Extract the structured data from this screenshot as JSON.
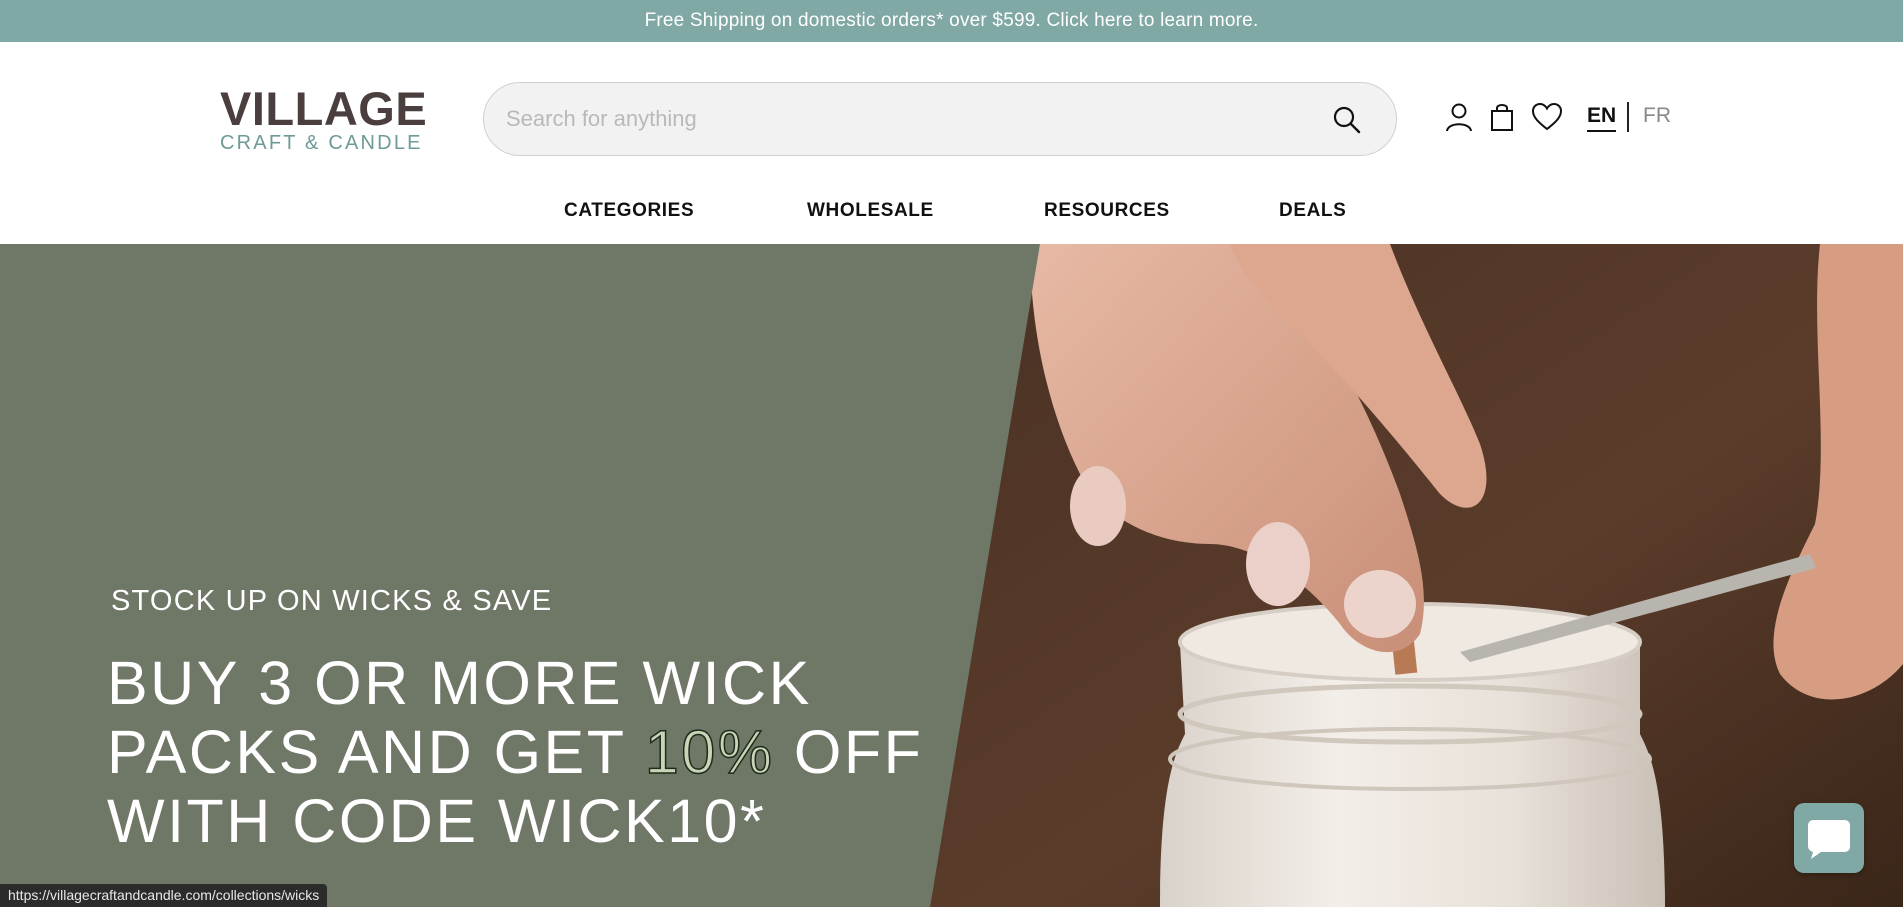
{
  "announcement": {
    "text": "Free Shipping on domestic orders* over $599. Click here to learn more."
  },
  "logo": {
    "main": "VILLAGE",
    "sub": "CRAFT & CANDLE"
  },
  "search": {
    "placeholder": "Search for anything",
    "value": "",
    "icon": "search-icon"
  },
  "header_icons": [
    "account-icon",
    "cart-icon",
    "wishlist-heart-icon"
  ],
  "language": {
    "active": "EN",
    "other": "FR"
  },
  "nav": {
    "items": [
      {
        "label": "CATEGORIES"
      },
      {
        "label": "WHOLESALE"
      },
      {
        "label": "RESOURCES"
      },
      {
        "label": "DEALS"
      }
    ]
  },
  "hero": {
    "kicker": "STOCK UP ON WICKS & SAVE",
    "headline_part1": "BUY 3 OR MORE WICK",
    "headline_part2": "PACKS AND GET ",
    "headline_highlight": "10%",
    "headline_part3": " OFF",
    "headline_part4": "WITH CODE WICK10*"
  },
  "status_bar": {
    "url": "https://villagecraftandcandle.com/collections/wicks"
  },
  "chat": {
    "icon": "chat-bubble-icon"
  },
  "colors": {
    "announcement_bg": "#80a8a4",
    "logo_main": "#4a3f3e",
    "logo_sub": "#6e9a97",
    "hero_bg": "#6f7767",
    "highlight": "#c8d4b5"
  }
}
